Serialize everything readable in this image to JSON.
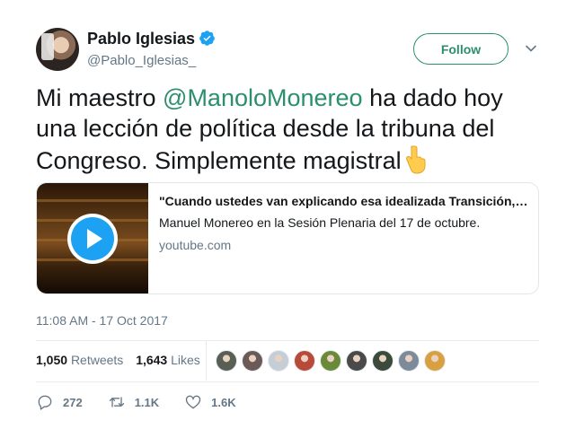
{
  "author": {
    "name": "Pablo Iglesias",
    "handle": "@Pablo_Iglesias_",
    "verified": true
  },
  "follow_label": "Follow",
  "tweet": {
    "text_before": "Mi maestro ",
    "mention": "@ManoloMonereo",
    "text_after": " ha dado hoy una lección de política desde la tribuna del Congreso. Simplemente magistral",
    "emoji": "pointing-down-hand"
  },
  "card": {
    "title": "\"Cuando ustedes van explicando esa idealizada Transición, siempre ...",
    "description": "Manuel Monereo en la Sesión Plenaria del 17 de octubre.",
    "domain": "youtube.com",
    "media": "video-play-icon"
  },
  "timestamp": "11:08 AM - 17 Oct 2017",
  "stats": {
    "retweets_count": "1,050",
    "retweets_label": "Retweets",
    "likes_count": "1,643",
    "likes_label": "Likes"
  },
  "likers": [
    "#5a5f56",
    "#6b5a58",
    "#c5ced6",
    "#b84a3a",
    "#6a8a3a",
    "#4a4a4a",
    "#3b4a3a",
    "#7d8a9a",
    "#d8a040"
  ],
  "actions": {
    "reply_count": "272",
    "retweet_count": "1.1K",
    "like_count": "1.6K"
  },
  "colors": {
    "accent": "#2b8f6b",
    "link_blue": "#1da1f2",
    "muted": "#657786",
    "text": "#14171a"
  }
}
